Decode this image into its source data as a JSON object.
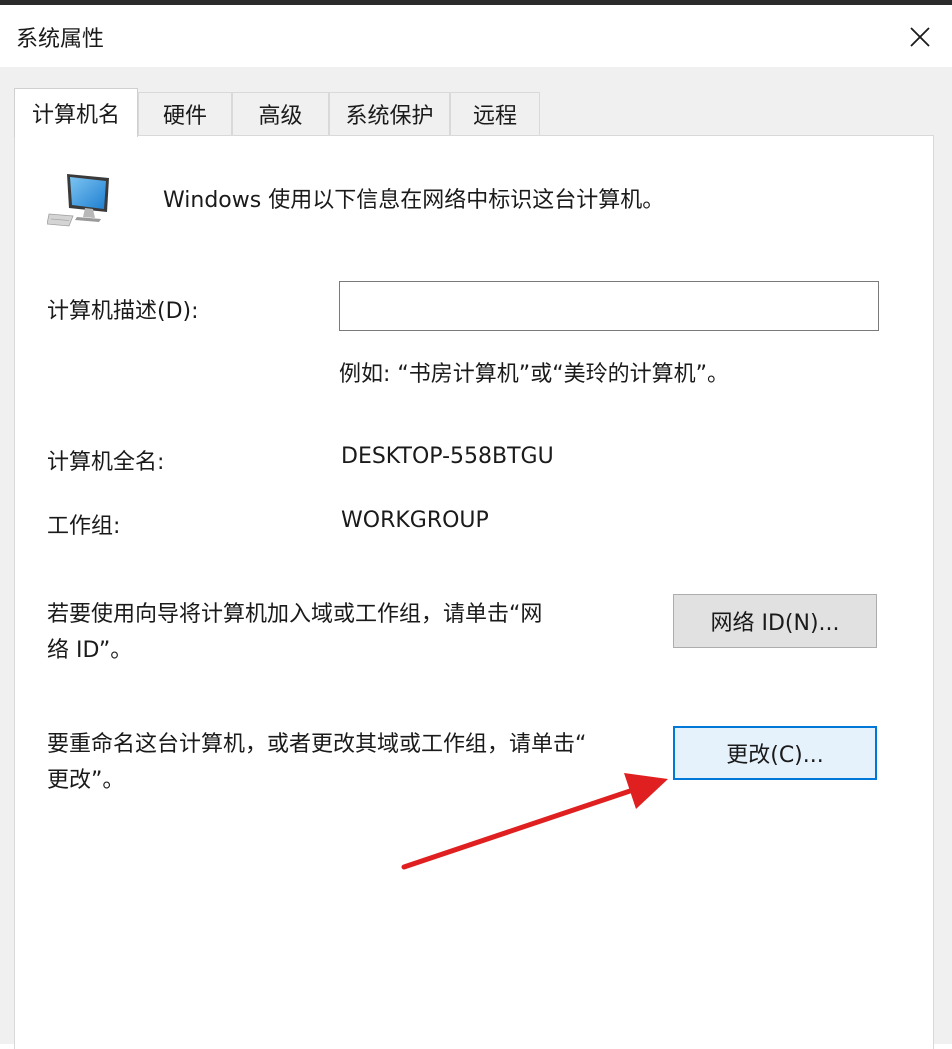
{
  "window": {
    "title": "系统属性"
  },
  "tabs": [
    {
      "label": "计算机名",
      "active": true
    },
    {
      "label": "硬件",
      "active": false
    },
    {
      "label": "高级",
      "active": false
    },
    {
      "label": "系统保护",
      "active": false
    },
    {
      "label": "远程",
      "active": false
    }
  ],
  "computer_name": {
    "intro": "Windows 使用以下信息在网络中标识这台计算机。",
    "description_label": "计算机描述(D):",
    "description_value": "",
    "description_example": "例如: “书房计算机”或“美玲的计算机”。",
    "full_name_label": "计算机全名:",
    "full_name_value": "DESKTOP-558BTGU",
    "workgroup_label": "工作组:",
    "workgroup_value": "WORKGROUP",
    "network_id_text_line1": "若要使用向导将计算机加入域或工作组，请单击“网",
    "network_id_text_line2": "络 ID”。",
    "network_id_button": "网络 ID(N)...",
    "rename_text_line1": "要重命名这台计算机，或者更改其域或工作组，请单击“",
    "rename_text_line2": "更改”。",
    "change_button": "更改(C)..."
  },
  "colors": {
    "accent": "#0078d7",
    "annotation_arrow": "#e02020"
  },
  "icons": {
    "close": "close-icon",
    "computer": "computer-monitor-icon",
    "annotation": "red-arrow-annotation"
  }
}
